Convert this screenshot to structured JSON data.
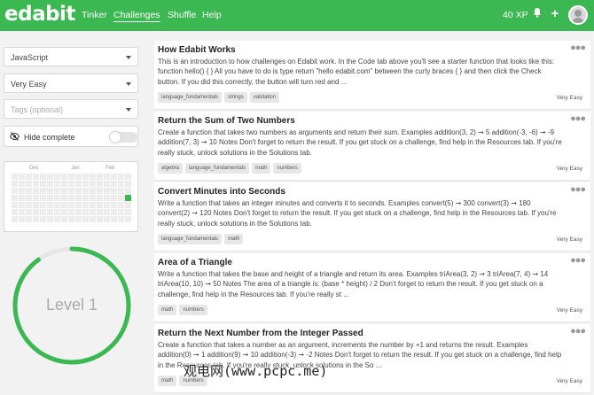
{
  "header": {
    "logo": "edabit",
    "nav": [
      "Tinker",
      "Challenges",
      "Shuffle",
      "Help"
    ],
    "xp": "40 XP",
    "bg": "#3cb852"
  },
  "sidebar": {
    "language": "JavaScript",
    "difficulty": "Very Easy",
    "tags_placeholder": "Tags (optional)",
    "hide_complete": "Hide complete",
    "months": [
      "Dec",
      "Jan",
      "Feb"
    ],
    "level": "Level 1",
    "level_progress": 0.9
  },
  "challenges": [
    {
      "title": "How Edabit Works",
      "desc": "This is an introduction to how challenges on Edabit work. In the Code tab above you'll see a starter function that looks like this: function hello() { } All you have to do is type return \"hello edabit.com\" between the curly braces { } and then click the Check button. If you did this correctly, the button will turn red and ...",
      "tags": [
        "language_fundamentals",
        "strings",
        "validation"
      ],
      "difficulty": "Very Easy"
    },
    {
      "title": "Return the Sum of Two Numbers",
      "desc": "Create a function that takes two numbers as arguments and return their sum. Examples addition(3, 2) ➞ 5 addition(-3, -6) ➞ -9 addition(7, 3) ➞ 10 Notes Don't forget to return the result. If you get stuck on a challenge, find help in the Resources tab. If you're really stuck, unlock solutions in the Solutions tab.",
      "tags": [
        "algebra",
        "language_fundamentals",
        "math",
        "numbers"
      ],
      "difficulty": "Very Easy"
    },
    {
      "title": "Convert Minutes into Seconds",
      "desc": "Write a function that takes an integer minutes and converts it to seconds. Examples convert(5) ➞ 300 convert(3) ➞ 180 convert(2) ➞ 120 Notes Don't forget to return the result. If you get stuck on a challenge, find help in the Resources tab. If you're really stuck, unlock solutions in the Solutions tab.",
      "tags": [
        "language_fundamentals",
        "math"
      ],
      "difficulty": "Very Easy"
    },
    {
      "title": "Area of a Triangle",
      "desc": "Write a function that takes the base and height of a triangle and return its area. Examples triArea(3, 2) ➞ 3 triArea(7, 4) ➞ 14 triArea(10, 10) ➞ 50 Notes The area of a triangle is: (base * height) / 2 Don't forget to return the result. If you get stuck on a challenge, find help in the Resources tab. If you're really st ...",
      "tags": [
        "math",
        "numbers"
      ],
      "difficulty": "Very Easy"
    },
    {
      "title": "Return the Next Number from the Integer Passed",
      "desc": "Create a function that takes a number as an argument, increments the number by +1 and returns the result. Examples addition(0) ➞ 1 addition(9) ➞ 10 addition(-3) ➞ -2 Notes Don't forget to return the result. If you get stuck on a challenge, find help in the Resources tab. If you're really stuck, unlock solutions in the So ...",
      "tags": [
        "math",
        "numbers"
      ],
      "difficulty": "Very Easy"
    }
  ],
  "watermark": "观电网(www.pcpc.me)"
}
